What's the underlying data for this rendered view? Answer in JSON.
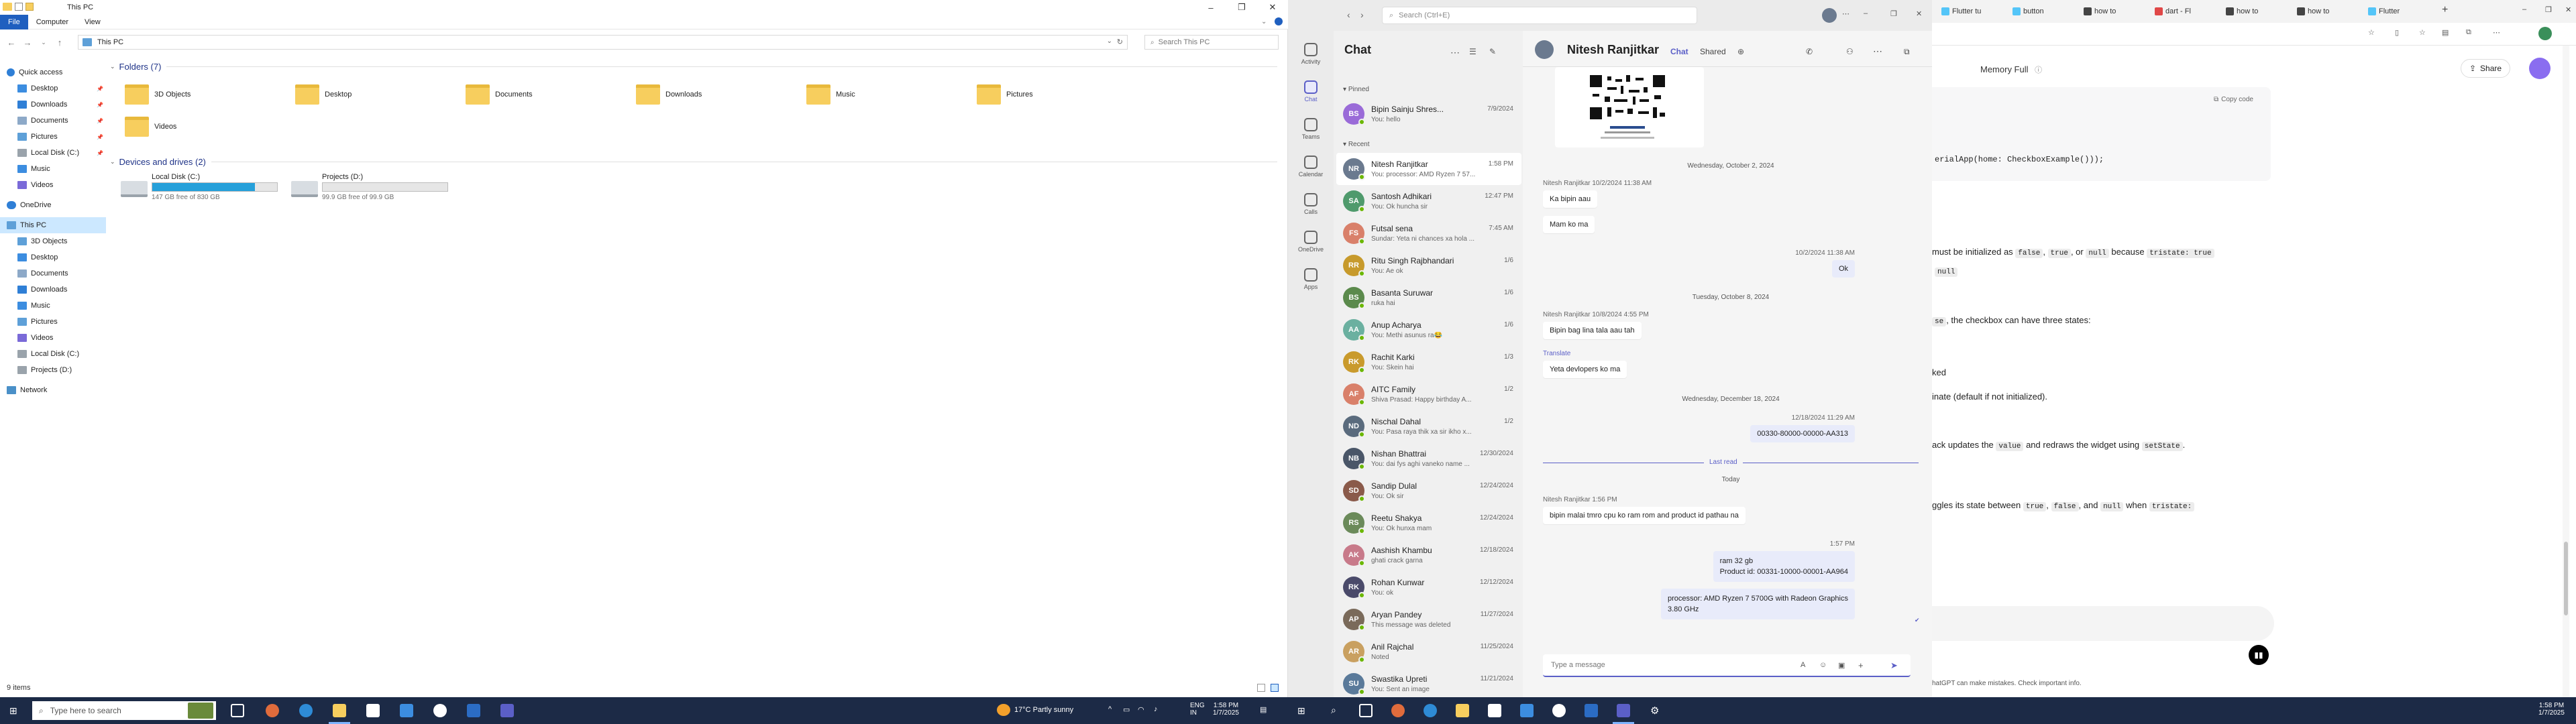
{
  "explorer": {
    "title": "This PC",
    "ribbon_tabs": [
      "File",
      "Computer",
      "View"
    ],
    "address": "This PC",
    "search_placeholder": "Search This PC",
    "nav": {
      "quick_access": "Quick access",
      "quick_items": [
        "Desktop",
        "Downloads",
        "Documents",
        "Pictures",
        "Local Disk (C:)",
        "Music",
        "Videos"
      ],
      "onedrive": "OneDrive",
      "this_pc": "This PC",
      "pc_items": [
        "3D Objects",
        "Desktop",
        "Documents",
        "Downloads",
        "Music",
        "Pictures",
        "Videos",
        "Local Disk (C:)",
        "Projects (D:)"
      ],
      "network": "Network"
    },
    "folders_header": "Folders (7)",
    "folders": [
      "3D Objects",
      "Desktop",
      "Documents",
      "Downloads",
      "Music",
      "Pictures",
      "Videos"
    ],
    "drives_header": "Devices and drives (2)",
    "drives": [
      {
        "name": "Local Disk (C:)",
        "free": "147 GB free of 830 GB",
        "used_fraction": 0.82
      },
      {
        "name": "Projects (D:)",
        "free": "99.9 GB free of 99.9 GB",
        "used_fraction": 0.0
      }
    ],
    "status": "9 items"
  },
  "teams": {
    "search_placeholder": "Search (Ctrl+E)",
    "rail": [
      "Activity",
      "Chat",
      "Teams",
      "Calendar",
      "Calls",
      "OneDrive",
      "Apps"
    ],
    "chat_header": "Chat",
    "pinned_label": "Pinned",
    "recent_label": "Recent",
    "pinned": [
      {
        "initials": "BS",
        "name": "Bipin Sainju Shres...",
        "date": "7/9/2024",
        "preview": "You: hello",
        "color": "#9a6bd8"
      }
    ],
    "recent": [
      {
        "initials": "NR",
        "name": "Nitesh Ranjitkar",
        "date": "1:58 PM",
        "preview": "You: processor: AMD Ryzen 7 57...",
        "color": "#6b7a8f"
      },
      {
        "initials": "SA",
        "name": "Santosh Adhikari",
        "date": "12:47 PM",
        "preview": "You: Ok huncha sir",
        "color": "#4f9a6c"
      },
      {
        "initials": "FS",
        "name": "Futsal sena",
        "date": "7:45 AM",
        "preview": "Sundar: Yeta ni chances xa hola ...",
        "color": "#d9806a"
      },
      {
        "initials": "RR",
        "name": "Ritu Singh Rajbhandari",
        "date": "1/6",
        "preview": "You: Ae ok",
        "color": "#c79a2c"
      },
      {
        "initials": "BS",
        "name": "Basanta Suruwar",
        "date": "1/6",
        "preview": "ruka hai",
        "color": "#5b8a4c"
      },
      {
        "initials": "AA",
        "name": "Anup Acharya",
        "date": "1/6",
        "preview": "You: Methi asunus ra😂",
        "color": "#6bb0a0"
      },
      {
        "initials": "RK",
        "name": "Rachit Karki",
        "date": "1/3",
        "preview": "You: Skein hai",
        "color": "#c99a2c"
      },
      {
        "initials": "AF",
        "name": "AITC Family",
        "date": "1/2",
        "preview": "Shiva Prasad: Happy birthday A...",
        "color": "#d9806a"
      },
      {
        "initials": "ND",
        "name": "Nischal Dahal",
        "date": "1/2",
        "preview": "You: Pasa raya thik xa sir ikho x...",
        "color": "#5a6b7d"
      },
      {
        "initials": "NB",
        "name": "Nishan Bhattrai",
        "date": "12/30/2024",
        "preview": "You: dai fys aghi vaneko name ...",
        "color": "#4a5668"
      },
      {
        "initials": "SD",
        "name": "Sandip Dulal",
        "date": "12/24/2024",
        "preview": "You: Ok sir",
        "color": "#8a5a4a"
      },
      {
        "initials": "RS",
        "name": "Reetu Shakya",
        "date": "12/24/2024",
        "preview": "You: Ok hunxa mam",
        "color": "#6b8a5a"
      },
      {
        "initials": "AK",
        "name": "Aashish Khambu",
        "date": "12/18/2024",
        "preview": "ghati crack garna",
        "color": "#c87a8a"
      },
      {
        "initials": "RK",
        "name": "Rohan Kunwar",
        "date": "12/12/2024",
        "preview": "You: ok",
        "color": "#4a4a6a"
      },
      {
        "initials": "AP",
        "name": "Aryan Pandey",
        "date": "11/27/2024",
        "preview": "This message was deleted",
        "color": "#7a6a5a"
      },
      {
        "initials": "AR",
        "name": "Anil Rajchal",
        "date": "11/25/2024",
        "preview": "Noted",
        "color": "#c9a060"
      },
      {
        "initials": "SU",
        "name": "Swastika Upreti",
        "date": "11/21/2024",
        "preview": "You: Sent an image",
        "color": "#5a7a9a"
      }
    ],
    "conv": {
      "name": "Nitesh Ranjitkar",
      "tabs": [
        "Chat",
        "Shared"
      ],
      "messages": {
        "date1": "Wednesday, October 2, 2024",
        "meta1": "Nitesh Ranjitkar  10/2/2024 11:38 AM",
        "m1": "Ka bipin aau",
        "m2": "Mam ko ma",
        "meta2": "10/2/2024 11:38 AM",
        "m3": "Ok",
        "date2": "Tuesday, October 8, 2024",
        "meta3": "Nitesh Ranjitkar  10/8/2024 4:55 PM",
        "m4": "Bipin bag lina tala aau tah",
        "translate": "Translate",
        "m5": "Yeta devlopers ko ma",
        "date3": "Wednesday, December 18, 2024",
        "meta4": "12/18/2024 11:29 AM",
        "m6": "00330-80000-00000-AA313",
        "last_read": "Last read",
        "today": "Today",
        "meta5": "Nitesh Ranjitkar  1:56 PM",
        "m7": "bipin malai tmro cpu ko ram rom and product id pathau na",
        "meta6": "1:57 PM",
        "m8a": "ram 32 gb",
        "m8b": "Product id: 00331-10000-00001-AA964",
        "m9a": "processor: AMD Ryzen 7 5700G with Radeon Graphics",
        "m9b": "3.80 GHz"
      },
      "compose_placeholder": "Type a message"
    }
  },
  "edge": {
    "tabs": [
      "Flutter tu",
      "button",
      "how to",
      "dart - Fl",
      "how to",
      "how to",
      "Flutter"
    ],
    "page_title": "Memory Full",
    "share_label": "Share",
    "copy_code": "Copy code",
    "code_line": "erialApp(home: CheckboxExample()));",
    "text1_pre": "must be initialized as",
    "text1_c1": "false",
    "text1_c2": "true",
    "text1_or": ", or",
    "text1_c3": "null",
    "text1_post": "because",
    "text1_c4": "tristate: true",
    "text1b_c": "null",
    "text2_pre": "se",
    "text2": ", the checkbox can have three states:",
    "text3": "ked",
    "text4": "inate (default if not initialized).",
    "text5_pre": "ack updates the",
    "text5_c1": "value",
    "text5_mid": "and redraws the widget using",
    "text5_c2": "setState",
    "text6_pre": "ggles its state between",
    "text6_c1": "true",
    "text6_c2": "false",
    "text6_and": ", and",
    "text6_c3": "null",
    "text6_when": "when",
    "text6_c4": "tristate:",
    "footer": "hatGPT can make mistakes. Check important info."
  },
  "taskbar_left": {
    "search_placeholder": "Type here to search",
    "weather": "17°C  Partly sunny",
    "lang1": "ENG",
    "lang2": "IN",
    "time": "1:58 PM",
    "date": "1/7/2025"
  },
  "taskbar_right": {
    "time": "1:58 PM",
    "date": "1/7/2025"
  },
  "colors": {
    "teams_accent": "#5b5fc7",
    "explorer_accent": "#1f5fbf",
    "taskbar": "#1c2a46"
  }
}
